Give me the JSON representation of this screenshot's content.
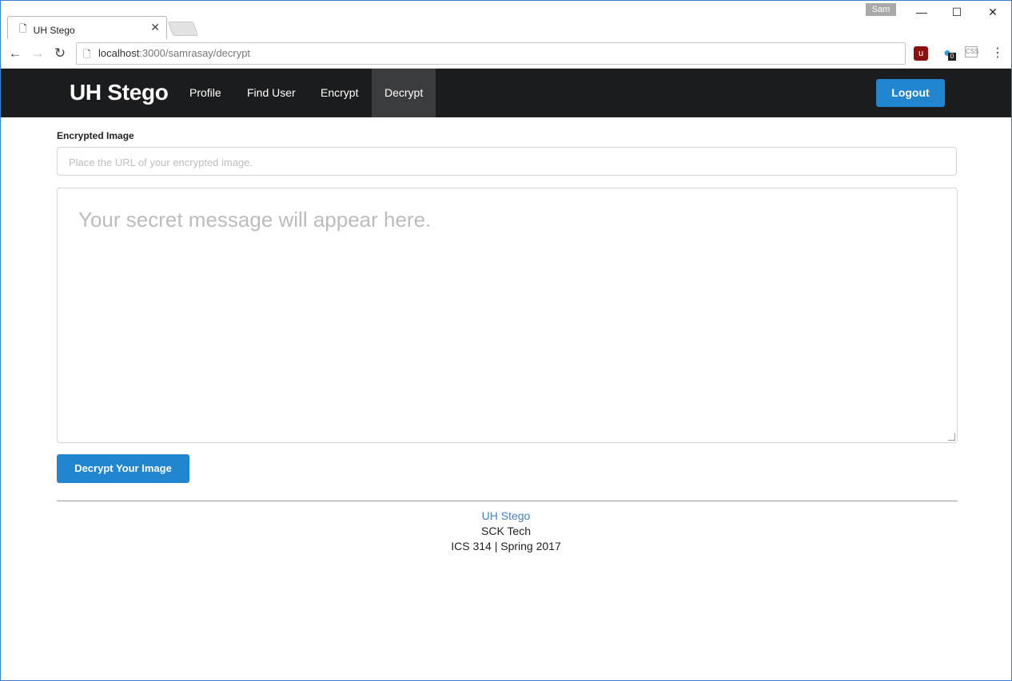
{
  "browser": {
    "tab_title": "UH Stego",
    "tab_close": "✕",
    "profile_name": "Sam",
    "url_host": "localhost",
    "url_path": ":3000/samrasay/decrypt",
    "ext_ublock_badge": "0"
  },
  "navbar": {
    "brand": "UH Stego",
    "items": [
      "Profile",
      "Find User",
      "Encrypt",
      "Decrypt"
    ],
    "active_item": "Decrypt",
    "logout_label": "Logout"
  },
  "form": {
    "image_label": "Encrypted Image",
    "image_placeholder": "Place the URL of your encrypted image.",
    "message_placeholder": "Your secret message will appear here.",
    "submit_label": "Decrypt Your Image"
  },
  "footer": {
    "link": "UH Stego",
    "line2": "SCK Tech",
    "line3": "ICS 314 | Spring 2017"
  },
  "colors": {
    "navbar_bg": "#1b1c1d",
    "active_nav_bg": "#3b3c3d",
    "primary_button": "#2185d0",
    "link": "#4183c4"
  }
}
